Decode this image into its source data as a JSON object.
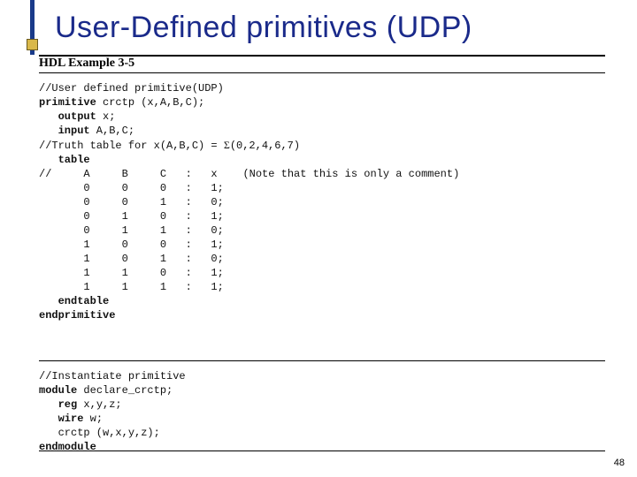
{
  "title": "User-Defined primitives (UDP)",
  "hdl_heading": "HDL Example 3-5",
  "code": {
    "c01": "//User defined primitive(UDP)",
    "c02a": "primitive",
    "c02b": " crctp (x,A,B,C);",
    "c03a": "   output",
    "c03b": " x;",
    "c04a": "   input",
    "c04b": " A,B,C;",
    "c05a": "//Truth table for x(A,B,C) = ",
    "c05b": "Σ",
    "c05c": "(0,2,4,6,7)",
    "c06": "   table",
    "c07": "//     A     B     C   :   x    (Note that this is only a comment)",
    "r1": "       0     0     0   :   1;",
    "r2": "       0     0     1   :   0;",
    "r3": "       0     1     0   :   1;",
    "r4": "       0     1     1   :   0;",
    "r5": "       1     0     0   :   1;",
    "r6": "       1     0     1   :   0;",
    "r7": "       1     1     0   :   1;",
    "r8": "       1     1     1   :   1;",
    "c16": "   endtable",
    "c17": "endprimitive",
    "c18": "//Instantiate primitive",
    "c19a": "module",
    "c19b": " declare_crctp;",
    "c20a": "   reg",
    "c20b": " x,y,z;",
    "c21a": "   wire",
    "c21b": " w;",
    "c22": "   crctp (w,x,y,z);",
    "c23": "endmodule"
  },
  "pagenum": "48"
}
